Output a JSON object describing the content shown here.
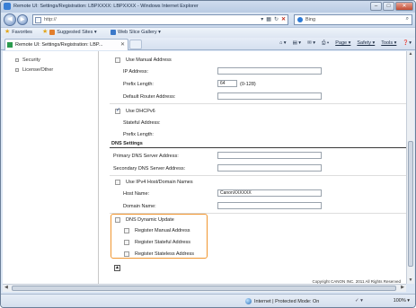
{
  "browser": {
    "title": "Remote UI: Settings/Registration: LBPXXXX: LBPXXXX - Windows Internet Explorer",
    "url": "http://",
    "search_text": "Bing",
    "favorites": {
      "label": "Favorites",
      "suggested_sites": "Suggested Sites ▾",
      "web_slice_gallery": "Web Slice Gallery ▾"
    },
    "tab_label": "Remote UI: Settings/Registration: LBP...",
    "menu": {
      "page": "Page ▾",
      "safety": "Safety ▾",
      "tools": "Tools ▾",
      "help": "❓▾"
    },
    "status": {
      "zone": "Internet | Protected Mode: On",
      "zoom": "100% ▾"
    }
  },
  "sidebar": {
    "items": [
      "Security",
      "License/Other"
    ]
  },
  "ipv6": {
    "use_manual_address": "Use Manual Address",
    "ip_address_label": "IP Address:",
    "ip_address_value": "",
    "prefix_length_label": "Prefix Length:",
    "prefix_length_value": "64",
    "prefix_range": "(0-128)",
    "default_router_label": "Default Router Address:",
    "default_router_value": "",
    "use_dhcpv6": "Use DHCPv6",
    "stateful_address_label": "Stateful Address:",
    "dhcp_prefix_length_label": "Prefix Length:"
  },
  "dns": {
    "section_title": "DNS Settings",
    "primary_label": "Primary DNS Server Address:",
    "primary_value": "",
    "secondary_label": "Secondary DNS Server Address:",
    "secondary_value": "",
    "use_ipv4_host": "Use IPv4 Host/Domain Names",
    "host_name_label": "Host Name:",
    "host_name_value": "CanonXXXXXX",
    "domain_name_label": "Domain Name:",
    "domain_name_value": "",
    "dynamic_update": "DNS Dynamic Update",
    "register_manual": "Register Manual Address",
    "register_stateful": "Register Stateful Address",
    "register_stateless": "Register Stateless Address"
  },
  "footer": {
    "copyright": "Copyright CANON INC. 2011 All Rights Reserved"
  },
  "colors": {
    "highlight": "#f0962f",
    "chrome": "#dbe6f4"
  }
}
